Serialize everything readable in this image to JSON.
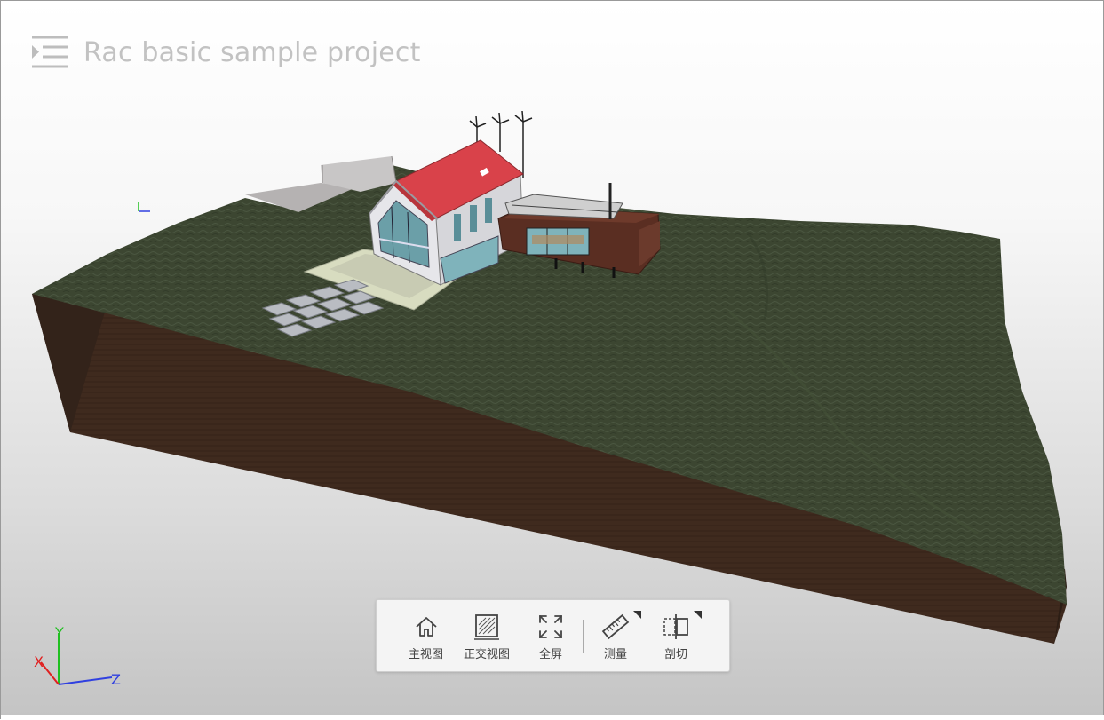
{
  "project": {
    "title": "Rac basic sample project"
  },
  "axes": {
    "x_label": "X",
    "y_label": "Y",
    "z_label": "Z",
    "x_color": "#e02020",
    "y_color": "#20c020",
    "z_color": "#3040e0"
  },
  "toolbar": {
    "home_label": "主视图",
    "ortho_label": "正交视图",
    "fullscreen_label": "全屏",
    "measure_label": "测量",
    "section_label": "剖切"
  },
  "colors": {
    "roof": "#d9424a",
    "grass": "#3c4631",
    "soil": "#3f2a1e"
  }
}
